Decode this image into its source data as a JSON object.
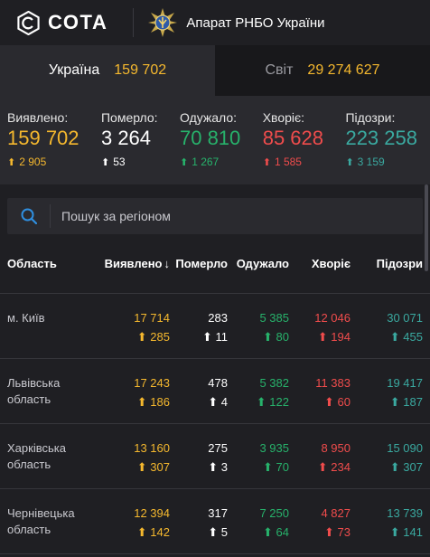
{
  "header": {
    "logo_text": "СОТА",
    "org_title": "Апарат РНБО України"
  },
  "tabs": [
    {
      "label": "Україна",
      "value": "159 702",
      "active": true
    },
    {
      "label": "Світ",
      "value": "29 274 627",
      "active": false
    }
  ],
  "stats": [
    {
      "label": "Виявлено:",
      "value": "159 702",
      "delta": "2 905",
      "color": "#f5b82e"
    },
    {
      "label": "Померло:",
      "value": "3 264",
      "delta": "53",
      "color": "#ffffff"
    },
    {
      "label": "Одужало:",
      "value": "70 810",
      "delta": "1 267",
      "color": "#27b26b"
    },
    {
      "label": "Хворіє:",
      "value": "85 628",
      "delta": "1 585",
      "color": "#f04c4c"
    },
    {
      "label": "Підозри:",
      "value": "223 258",
      "delta": "3 159",
      "color": "#3aa9a0"
    }
  ],
  "search": {
    "placeholder": "Пошук за регіоном",
    "icon": "search-icon"
  },
  "table": {
    "headers": {
      "region": "Область",
      "confirmed": "Виявлено",
      "sort_arrow": "↓",
      "deaths": "Померло",
      "recovered": "Одужало",
      "sick": "Хворіє",
      "suspected": "Підозри"
    },
    "rows": [
      {
        "region": "м. Київ",
        "confirmed": "17 714",
        "confirmed_delta": "285",
        "deaths": "283",
        "deaths_delta": "11",
        "recovered": "5 385",
        "recovered_delta": "80",
        "sick": "12 046",
        "sick_delta": "194",
        "suspected": "30 071",
        "suspected_delta": "455"
      },
      {
        "region": "Львівська область",
        "confirmed": "17 243",
        "confirmed_delta": "186",
        "deaths": "478",
        "deaths_delta": "4",
        "recovered": "5 382",
        "recovered_delta": "122",
        "sick": "11 383",
        "sick_delta": "60",
        "suspected": "19 417",
        "suspected_delta": "187"
      },
      {
        "region": "Харківська область",
        "confirmed": "13 160",
        "confirmed_delta": "307",
        "deaths": "275",
        "deaths_delta": "3",
        "recovered": "3 935",
        "recovered_delta": "70",
        "sick": "8 950",
        "sick_delta": "234",
        "suspected": "15 090",
        "suspected_delta": "307"
      },
      {
        "region": "Чернівецька область",
        "confirmed": "12 394",
        "confirmed_delta": "142",
        "deaths": "317",
        "deaths_delta": "5",
        "recovered": "7 250",
        "recovered_delta": "64",
        "sick": "4 827",
        "sick_delta": "73",
        "suspected": "13 739",
        "suspected_delta": "141"
      }
    ]
  },
  "colors": {
    "confirmed": "#f5b82e",
    "deaths": "#ffffff",
    "recovered": "#27b26b",
    "sick": "#f04c4c",
    "suspected": "#3aa9a0"
  }
}
